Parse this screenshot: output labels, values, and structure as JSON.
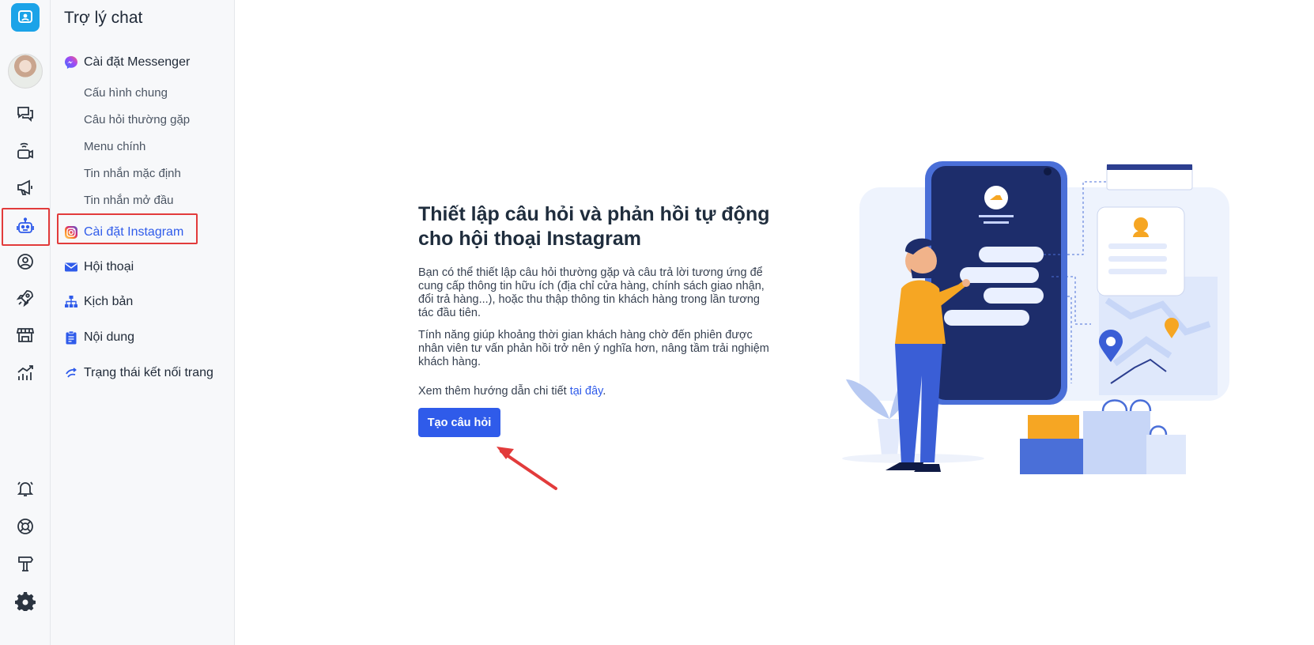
{
  "sidebar": {
    "title": "Trợ lý chat",
    "messenger": {
      "label": "Cài đặt Messenger",
      "items": [
        "Cấu hình chung",
        "Câu hỏi thường gặp",
        "Menu chính",
        "Tin nhắn mặc định",
        "Tin nhắn mở đầu"
      ]
    },
    "instagram": "Cài đặt Instagram",
    "conversation": "Hội thoại",
    "script": "Kịch bản",
    "content": "Nội dung",
    "status": "Trạng thái kết nối trang"
  },
  "main": {
    "title_line1": "Thiết lập câu hỏi và phản hồi tự động",
    "title_line2": "cho hội thoại Instagram",
    "para1_l1": "Bạn có thể thiết lập câu hỏi thường gặp và câu trả lời tương ứng để",
    "para1_l2": "cung cấp thông tin hữu ích (địa chỉ cửa hàng, chính sách giao nhận,",
    "para1_l3": "đổi trả hàng...), hoặc thu thập thông tin khách hàng trong lần tương",
    "para1_l4": "tác đầu tiên.",
    "para2_l1": "Tính năng giúp khoảng thời gian khách hàng chờ đến phiên được",
    "para2_l2": "nhân viên tư vấn phản hồi trở nên ý nghĩa hơn, nâng tầm trải nghiệm",
    "para2_l3": "khách hàng.",
    "more_text": "Xem thêm hướng dẫn chi tiết ",
    "more_link": "tại đây",
    "more_end": ".",
    "button": "Tạo câu hỏi"
  },
  "icons": {
    "rail": [
      "chat-icon",
      "livestream-icon",
      "megaphone-icon",
      "bot-icon",
      "user-circle-icon",
      "rocket-icon",
      "store-icon",
      "analytics-icon",
      "bell-icon",
      "lifebuoy-icon",
      "signpost-icon",
      "gear-icon"
    ]
  },
  "colors": {
    "accent": "#2f5bea",
    "highlight": "#e23b3b",
    "logo": "#1ba3e8"
  }
}
